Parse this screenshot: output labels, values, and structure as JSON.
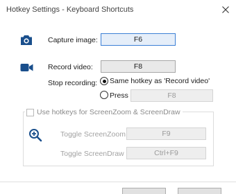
{
  "window": {
    "title": "Hotkey Settings - Keyboard Shortcuts"
  },
  "capture": {
    "label": "Capture image:",
    "hotkey": "F6"
  },
  "record": {
    "label": "Record video:",
    "hotkey": "F8"
  },
  "stop_recording": {
    "label": "Stop recording:",
    "option_same": "Same hotkey as 'Record video'",
    "option_press": "Press",
    "press_hotkey": "F8",
    "selected": "same"
  },
  "screenzoom_group": {
    "checkbox_label": "Use hotkeys for ScreenZoom & ScreenDraw",
    "checked": false,
    "toggle_zoom_label": "Toggle ScreenZoom",
    "toggle_zoom_hotkey": "F9",
    "toggle_draw_label": "Toggle ScreenDraw",
    "toggle_draw_hotkey": "Ctrl+F9"
  },
  "icons": {
    "camera": "camera-icon",
    "video": "video-camera-icon",
    "zoom": "zoom-in-icon",
    "close": "close-icon"
  },
  "colors": {
    "accent_icon": "#1a4f8c",
    "focus_border": "#3a7fd5"
  }
}
